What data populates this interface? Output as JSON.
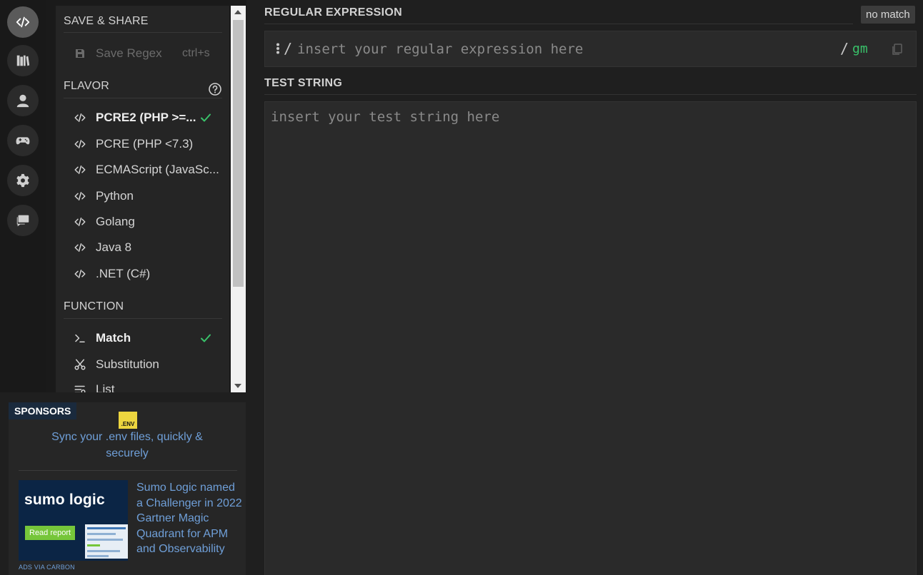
{
  "rail": {
    "items": [
      {
        "icon": "code-icon",
        "active": true
      },
      {
        "icon": "library-icon"
      },
      {
        "icon": "user-icon"
      },
      {
        "icon": "gamepad-icon"
      },
      {
        "icon": "gear-icon"
      },
      {
        "icon": "chat-icon"
      }
    ]
  },
  "sidebar": {
    "save_share_title": "SAVE & SHARE",
    "save_regex_label": "Save Regex",
    "save_regex_shortcut": "ctrl+s",
    "flavor_title": "FLAVOR",
    "flavors": [
      {
        "label": "PCRE2 (PHP >=...",
        "selected": true
      },
      {
        "label": "PCRE (PHP <7.3)"
      },
      {
        "label": "ECMAScript (JavaSc..."
      },
      {
        "label": "Python"
      },
      {
        "label": "Golang"
      },
      {
        "label": "Java 8"
      },
      {
        "label": ".NET (C#)"
      }
    ],
    "function_title": "FUNCTION",
    "functions": [
      {
        "label": "Match",
        "icon": "terminal-icon",
        "selected": true
      },
      {
        "label": "Substitution",
        "icon": "scissors-icon"
      },
      {
        "label": "List",
        "icon": "list-icon"
      }
    ]
  },
  "sponsors": {
    "tag": "SPONSORS",
    "env_logo_text": ".ENV",
    "link_text": "Sync your .env files, quickly & securely",
    "ad": {
      "brand": "sumo logic",
      "cta": "Read report",
      "text": "Sumo Logic named a Challenger in 2022 Gartner Magic Quadrant for APM and Observability",
      "via": "ADS VIA CARBON"
    }
  },
  "main": {
    "regex_title": "REGULAR EXPRESSION",
    "match_status": "no match",
    "regex_delimiter_open": "/",
    "regex_placeholder": "insert your regular expression here",
    "regex_value": "",
    "regex_delimiter_close": "/",
    "flags": "gm",
    "test_title": "TEST STRING",
    "test_placeholder": "insert your test string here",
    "test_value": ""
  },
  "colors": {
    "accent_green": "#39c26a",
    "link_blue": "#6f9fd8",
    "background": "#1f1f1f"
  }
}
